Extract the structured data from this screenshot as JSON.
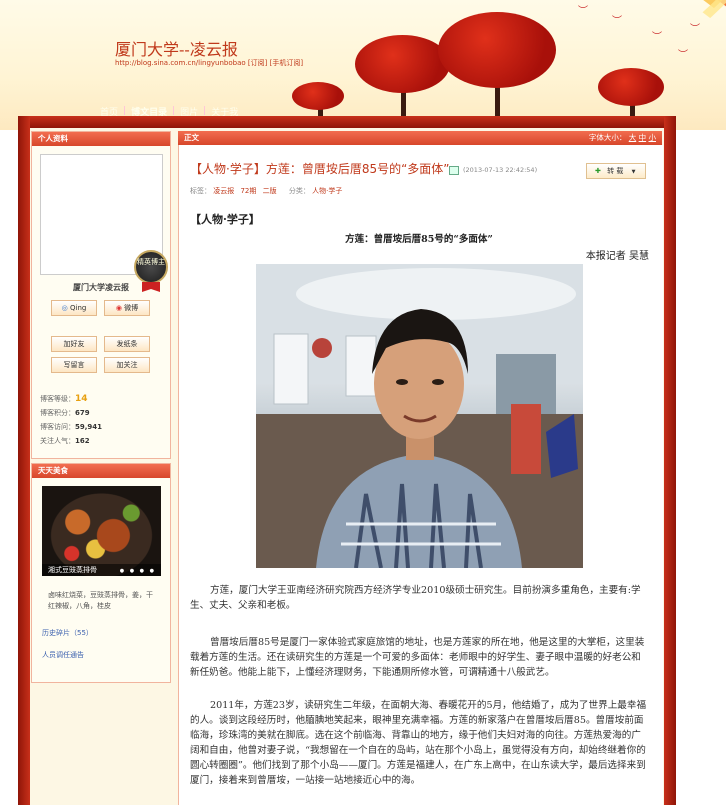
{
  "header": {
    "blog_title": "厦门大学--凌云报",
    "blog_url": "http://blog.sina.com.cn/lingyunbobao  [订阅] [手机订阅]",
    "nav": [
      {
        "label": "首页"
      },
      {
        "label": "博文目录"
      },
      {
        "label": "图片"
      },
      {
        "label": "关于我"
      }
    ]
  },
  "profile": {
    "panel_title": "个人资料",
    "badge_text": "精英博主",
    "name": "厦门大学凌云报",
    "qing_label": "Qing",
    "weibo_label": "微博",
    "add_friend": "加好友",
    "send_note": "发纸条",
    "write_msg": "写留言",
    "follow": "加关注",
    "stats": {
      "level_label": "博客等级：",
      "level_value": "14",
      "points_label": "博客积分：",
      "points_value": "679",
      "visits_label": "博客访问：",
      "visits_value": "59,941",
      "popularity_label": "关注人气：",
      "popularity_value": "162"
    }
  },
  "food": {
    "panel_title": "天天美食",
    "caption": "湘式豆豉蒸排骨",
    "dots": "● ● ● ●",
    "desc": "卤味红烧菜，豆豉蒸排骨，姜，干红辣椒，八角，桂皮",
    "history_link": "历史碎片（55）",
    "notice_link": "人员调任通告"
  },
  "article": {
    "panel_title": "正文",
    "font_size_label": "字体大小：",
    "font_sizes": [
      "大",
      "中",
      "小"
    ],
    "title": "【人物·学子】方莲：曾厝垵后厝85号的“多面体”",
    "timestamp": "(2013-07-13 22:42:54)",
    "repost_label": "转 载",
    "tags_label": "标签：",
    "tags": [
      "凌云报",
      "72期",
      "二版"
    ],
    "category_label": "分类：",
    "category": "人物·学子",
    "section_title": "【人物·学子】",
    "subtitle": "方莲：曾厝垵后厝85号的“多面体”",
    "reporter": "本报记者  吴慧",
    "paragraphs": [
      "方莲，厦门大学王亚南经济研究院西方经济学专业2010级硕士研究生。目前扮演多重角色，主要有:学生、丈夫、父亲和老板。",
      "曾厝垵后厝85号是厦门一家体验式家庭旅馆的地址，也是方莲家的所在地，他是这里的大掌柜，这里装载着方莲的生活。还在读研究生的方莲是一个可爱的多面体：老师眼中的好学生、妻子眼中温暖的好老公和新任奶爸。他能上能下，上懂经济理财务，下能通厕所修水管，可谓精通十八般武艺。",
      "2011年，方莲23岁，读研究生二年级，在面朝大海、春暖花开的5月，他结婚了，成为了世界上最幸福的人。谈到这段经历时，他腼腆地笑起来，眼神里充满幸福。方莲的新家落户在曾厝垵后厝85。曾厝垵前面临海，珍珠湾的美就在脚底。选在这个前临海、背靠山的地方，缘于他们夫妇对海的向往。方莲热爱海的广阔和自由，他曾对妻子说，“我想留在一个自在的岛屿，站在那个小岛上，虽觉得没有方向，却始终继着你的圆心转圈圈”。他们找到了那个小岛——厦门。方莲是福建人，在广东上高中，在山东读大学，最后选择来到厦门，接着来到曾厝垵，一站接一站地接近心中的海。"
    ]
  }
}
